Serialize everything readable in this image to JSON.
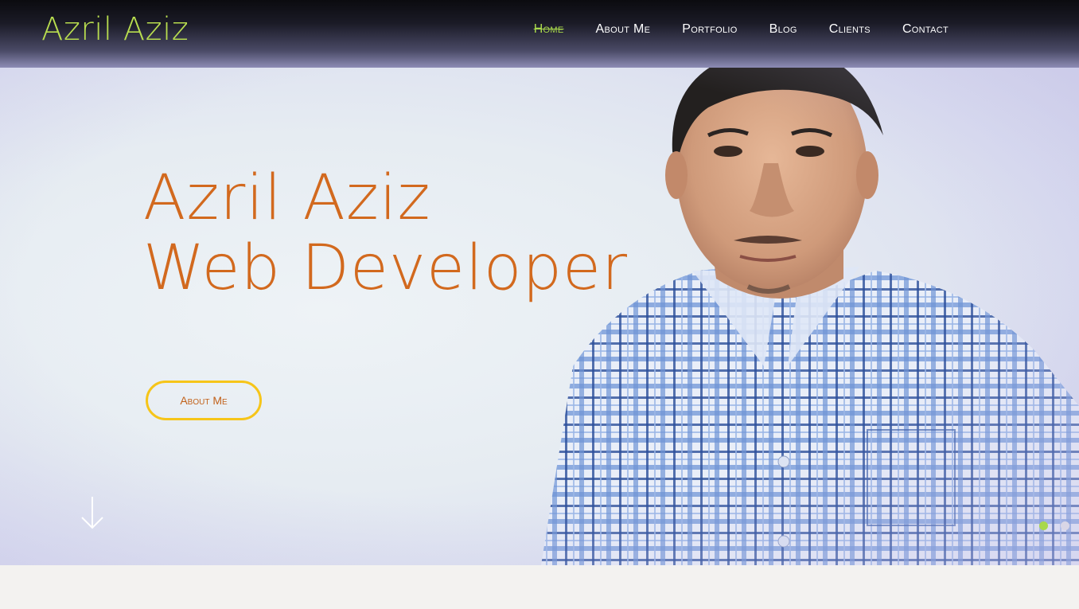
{
  "brand": {
    "name": "Azril Aziz"
  },
  "nav": {
    "items": [
      {
        "label": "Home",
        "active": true
      },
      {
        "label": "About Me"
      },
      {
        "label": "Portfolio"
      },
      {
        "label": "Blog"
      },
      {
        "label": "Clients"
      },
      {
        "label": "Contact"
      }
    ]
  },
  "hero": {
    "headline_line1": "Azril Aziz",
    "headline_line2": "Web Developer",
    "cta_label": "About Me",
    "scroll_icon": "arrow-down-icon",
    "slide_count": 2,
    "active_slide": 1
  },
  "colors": {
    "accent_green": "#a8d84b",
    "headline_orange": "#d2691e",
    "button_border": "#f6c519"
  }
}
